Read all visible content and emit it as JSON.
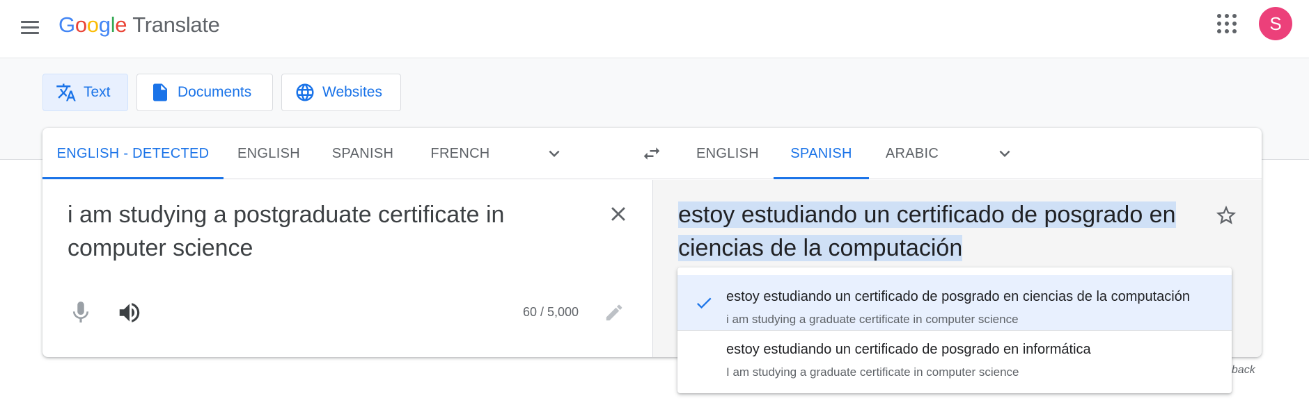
{
  "header": {
    "logo_google": [
      "G",
      "o",
      "o",
      "g",
      "l",
      "e"
    ],
    "product": "Translate",
    "avatar_initial": "S"
  },
  "modes": [
    {
      "label": "Text",
      "active": true
    },
    {
      "label": "Documents",
      "active": false
    },
    {
      "label": "Websites",
      "active": false
    }
  ],
  "source_langs": [
    {
      "label": "ENGLISH - DETECTED",
      "selected": true
    },
    {
      "label": "ENGLISH",
      "selected": false
    },
    {
      "label": "SPANISH",
      "selected": false
    },
    {
      "label": "FRENCH",
      "selected": false
    }
  ],
  "target_langs": [
    {
      "label": "ENGLISH",
      "selected": false
    },
    {
      "label": "SPANISH",
      "selected": true
    },
    {
      "label": "ARABIC",
      "selected": false
    }
  ],
  "source": {
    "text": "i am studying a postgraduate certificate in computer science",
    "char_count": "60 / 5,000"
  },
  "target": {
    "text": "estoy estudiando un certificado de posgrado en ciencias de la computación"
  },
  "alternatives": [
    {
      "text": "estoy estudiando un certificado de posgrado en ciencias de la computación",
      "back": "i am studying a graduate certificate in computer science",
      "selected": true
    },
    {
      "text": "estoy estudiando un certificado de posgrado en informática",
      "back": "I am studying a graduate certificate in computer science",
      "selected": false
    }
  ],
  "feedback_label": "dback",
  "colors": {
    "accent": "#1a73e8",
    "avatar": "#ec407a",
    "highlight": "#cfe0f6"
  }
}
